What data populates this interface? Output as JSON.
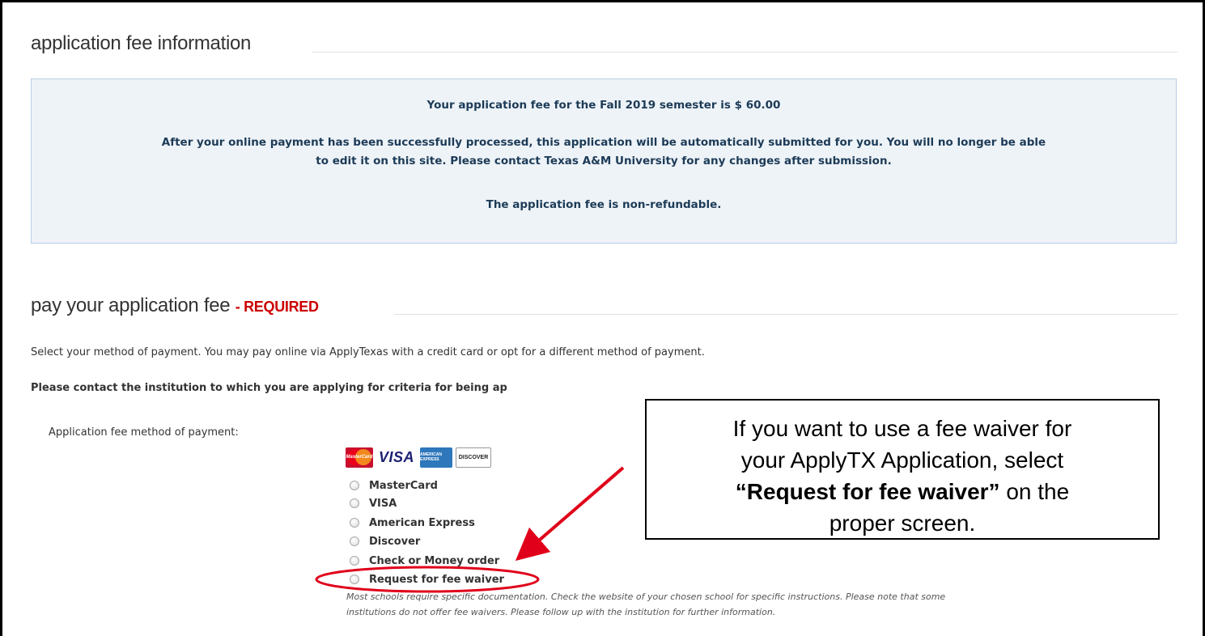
{
  "fee_section": {
    "heading": "application fee information",
    "line1": "Your application fee for the Fall 2019 semester is $ 60.00",
    "line2a": "After your online payment has been successfully processed, this application will be automatically submitted for you. You will no longer be able",
    "line2b": "to edit it on this site. Please contact Texas A&M University for any changes after submission.",
    "line3": "The application fee is non-refundable."
  },
  "pay_section": {
    "heading": "pay your application fee",
    "required": "- REQUIRED",
    "instructions": "Select your method of payment. You may pay online via ApplyTexas with a credit card or opt for a different method of payment.",
    "contact_note": "Please contact the institution to which you are applying for criteria for being ap",
    "method_label": "Application fee method of payment:",
    "cards": [
      {
        "name": "mastercard-logo",
        "text": "MasterCard"
      },
      {
        "name": "visa-logo",
        "text": "VISA"
      },
      {
        "name": "amex-logo",
        "text": "AMERICAN EXPRESS"
      },
      {
        "name": "discover-logo",
        "text": "DISCOVER"
      }
    ],
    "options": [
      {
        "label": "MasterCard"
      },
      {
        "label": "VISA"
      },
      {
        "label": "American Express"
      },
      {
        "label": "Discover"
      },
      {
        "label": "Check or Money order"
      },
      {
        "label": "Request for fee waiver"
      }
    ],
    "waiver_note_1": "Most schools require specific documentation. Check the website of your chosen school for specific instructions. Please note that some",
    "waiver_note_2": "institutions do not offer fee waivers. Please follow up with the institution for further information."
  },
  "callout": {
    "line1": "If you want to use a fee waiver for",
    "line2": "your ApplyTX Application, select",
    "line3_bold": "“Request for fee waiver”",
    "line3_rest": " on the",
    "line4": "proper screen."
  },
  "colors": {
    "required": "#cc0000",
    "info_bg": "#eef3f8",
    "info_text": "#1c3b57",
    "annotation": "#e0001a"
  }
}
